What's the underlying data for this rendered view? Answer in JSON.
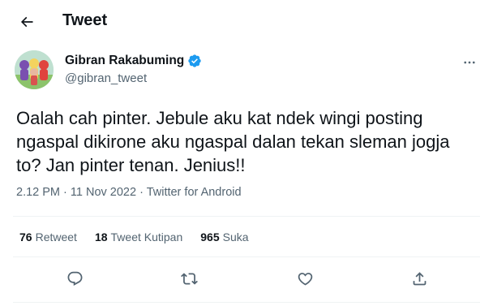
{
  "header": {
    "title": "Tweet",
    "back_icon": "arrow-left-icon"
  },
  "author": {
    "display_name": "Gibran Rakabuming",
    "handle": "@gibran_tweet",
    "verified_icon": "verified-badge-icon",
    "verified_color": "#1d9bf0"
  },
  "tweet": {
    "lines": [
      "Oalah cah pinter. Jebule aku kat ndek wingi posting",
      "ngaspal dikirone aku ngaspal dalan tekan sleman jogja",
      "to? Jan pinter tenan. Jenius!!"
    ],
    "time": "2.12 PM",
    "date": "11 Nov 2022",
    "source": "Twitter for Android"
  },
  "stats": [
    {
      "count": "76",
      "label": "Retweet"
    },
    {
      "count": "18",
      "label": "Tweet Kutipan"
    },
    {
      "count": "965",
      "label": "Suka"
    }
  ],
  "actions": [
    "reply-icon",
    "retweet-icon",
    "like-icon",
    "share-icon"
  ],
  "colors": {
    "text": "#0f1419",
    "secondary": "#536471",
    "divider": "#eff3f4",
    "accent": "#1d9bf0"
  }
}
